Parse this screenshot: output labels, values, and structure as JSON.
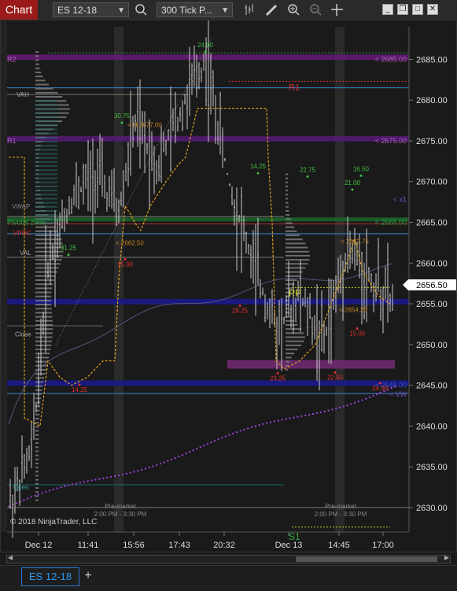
{
  "toolbar": {
    "tab_label": "Chart",
    "instrument": "ES 12-18",
    "interval": "300 Tick P...",
    "search_icon": "magnifier-icon",
    "bar_icon": "bar-style-icon",
    "pencil_icon": "drawing-tools-icon",
    "zoom_in_icon": "zoom-in-icon",
    "zoom_out_icon": "zoom-out-icon",
    "crosshair_icon": "crosshair-icon",
    "window_buttons": [
      "minimize",
      "maximize",
      "restore",
      "close"
    ]
  },
  "chart_data": {
    "type": "candlestick",
    "instrument": "ES 12-18",
    "y_axis_ticks": [
      "2685.00",
      "2680.00",
      "2675.00",
      "2670.00",
      "2665.00",
      "2660.00",
      "2655.00",
      "2650.00",
      "2645.00",
      "2640.00",
      "2635.00",
      "2630.00"
    ],
    "ylim": [
      2627,
      2689
    ],
    "last_price": "2656.50",
    "x_axis_ticks": [
      "Dec 12",
      "11:41",
      "15:56",
      "17:43",
      "20:32",
      "Dec 13",
      "14:45",
      "17:00"
    ],
    "level_labels": {
      "r2": "R2",
      "r1": "R1",
      "r1_small": "R1",
      "pp": "PP",
      "s1": "S1",
      "vah": "VAH",
      "vwap": "VWAP",
      "pivotal_zone": "Pivotal zone",
      "vpoc": "VPOC",
      "val": "VAL",
      "close": "Close",
      "open": "Open",
      "r2_right": "< 2685.00",
      "r1_right": "< 2675.00",
      "vwap_right_x1": "< x1",
      "pivotal_right": "< 2665.00",
      "s1_right": "< 2645.00",
      "vw_right": "< VW"
    },
    "swing_labels_green": [
      "24.00",
      "30.75",
      "14.25",
      "22.75",
      "16.50",
      "21.00",
      "31.25"
    ],
    "swing_labels_red": [
      "15.00",
      "29.25",
      "14.25",
      "23.25",
      "22.50",
      "15.00",
      "24.00"
    ],
    "price_labels": [
      "< H.2677.00",
      "< 2662.50",
      "< 2662.75",
      "< 2654.25"
    ],
    "session_labels": [
      {
        "title": "Pre-market",
        "range": "2:00 PM - 3:30 PM"
      },
      {
        "title": "Pre-market",
        "range": "2:00 PM - 3:30 PM"
      }
    ],
    "copyright": "© 2018 NinjaTrader, LLC"
  },
  "scrollbar": {
    "left_arrow": "◀",
    "right_arrow": "▶"
  },
  "bottom_tabs": {
    "active": "ES 12-18",
    "add": "+"
  }
}
